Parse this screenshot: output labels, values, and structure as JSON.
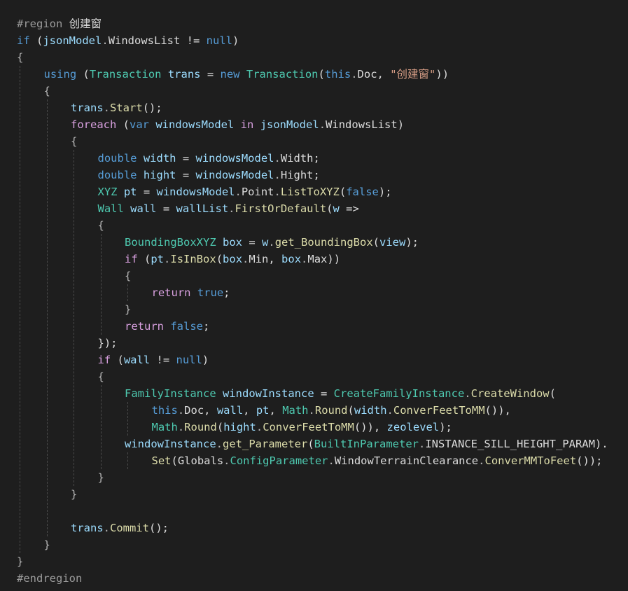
{
  "editor": {
    "language": "C#",
    "theme": "dark",
    "colors": {
      "background": "#1e1e1e",
      "keyword": "#569cd6",
      "control": "#d8a0df",
      "type": "#4ec9b0",
      "method": "#dcdcaa",
      "variable": "#9cdcfe",
      "string": "#d69d85",
      "preprocessor": "#9b9b9b"
    },
    "lines": [
      {
        "indent": 0,
        "tokens": [
          [
            "pp",
            "#region "
          ],
          [
            "plain",
            "创建窗"
          ]
        ]
      },
      {
        "indent": 0,
        "tokens": [
          [
            "kw",
            "if"
          ],
          [
            "plain",
            " ("
          ],
          [
            "var",
            "jsonModel"
          ],
          [
            "pun",
            "."
          ],
          [
            "prop",
            "WindowsList"
          ],
          [
            "plain",
            " != "
          ],
          [
            "kw",
            "null"
          ],
          [
            "plain",
            ")"
          ]
        ]
      },
      {
        "indent": 0,
        "tokens": [
          [
            "pun",
            "{"
          ]
        ]
      },
      {
        "indent": 1,
        "tokens": [
          [
            "kw",
            "using"
          ],
          [
            "plain",
            " ("
          ],
          [
            "ty",
            "Transaction"
          ],
          [
            "plain",
            " "
          ],
          [
            "var",
            "trans"
          ],
          [
            "plain",
            " = "
          ],
          [
            "kw",
            "new"
          ],
          [
            "plain",
            " "
          ],
          [
            "ty",
            "Transaction"
          ],
          [
            "plain",
            "("
          ],
          [
            "kw",
            "this"
          ],
          [
            "pun",
            "."
          ],
          [
            "prop",
            "Doc"
          ],
          [
            "plain",
            ", "
          ],
          [
            "str",
            "\"创建窗\""
          ],
          [
            "plain",
            "))"
          ]
        ]
      },
      {
        "indent": 1,
        "tokens": [
          [
            "pun",
            "{"
          ]
        ]
      },
      {
        "indent": 2,
        "tokens": [
          [
            "var",
            "trans"
          ],
          [
            "pun",
            "."
          ],
          [
            "fn",
            "Start"
          ],
          [
            "plain",
            "();"
          ]
        ]
      },
      {
        "indent": 2,
        "tokens": [
          [
            "ctl",
            "foreach"
          ],
          [
            "plain",
            " ("
          ],
          [
            "kw",
            "var"
          ],
          [
            "plain",
            " "
          ],
          [
            "var",
            "windowsModel"
          ],
          [
            "plain",
            " "
          ],
          [
            "ctl",
            "in"
          ],
          [
            "plain",
            " "
          ],
          [
            "var",
            "jsonModel"
          ],
          [
            "pun",
            "."
          ],
          [
            "prop",
            "WindowsList"
          ],
          [
            "plain",
            ")"
          ]
        ]
      },
      {
        "indent": 2,
        "tokens": [
          [
            "pun",
            "{"
          ]
        ]
      },
      {
        "indent": 3,
        "tokens": [
          [
            "kw",
            "double"
          ],
          [
            "plain",
            " "
          ],
          [
            "var",
            "width"
          ],
          [
            "plain",
            " = "
          ],
          [
            "var",
            "windowsModel"
          ],
          [
            "pun",
            "."
          ],
          [
            "prop",
            "Width"
          ],
          [
            "plain",
            ";"
          ]
        ]
      },
      {
        "indent": 3,
        "tokens": [
          [
            "kw",
            "double"
          ],
          [
            "plain",
            " "
          ],
          [
            "var",
            "hight"
          ],
          [
            "plain",
            " = "
          ],
          [
            "var",
            "windowsModel"
          ],
          [
            "pun",
            "."
          ],
          [
            "prop",
            "Hight"
          ],
          [
            "plain",
            ";"
          ]
        ]
      },
      {
        "indent": 3,
        "tokens": [
          [
            "ty",
            "XYZ"
          ],
          [
            "plain",
            " "
          ],
          [
            "var",
            "pt"
          ],
          [
            "plain",
            " = "
          ],
          [
            "var",
            "windowsModel"
          ],
          [
            "pun",
            "."
          ],
          [
            "prop",
            "Point"
          ],
          [
            "pun",
            "."
          ],
          [
            "fn",
            "ListToXYZ"
          ],
          [
            "plain",
            "("
          ],
          [
            "kw",
            "false"
          ],
          [
            "plain",
            ");"
          ]
        ]
      },
      {
        "indent": 3,
        "tokens": [
          [
            "ty",
            "Wall"
          ],
          [
            "plain",
            " "
          ],
          [
            "var",
            "wall"
          ],
          [
            "plain",
            " = "
          ],
          [
            "var",
            "wallList"
          ],
          [
            "pun",
            "."
          ],
          [
            "fn",
            "FirstOrDefault"
          ],
          [
            "plain",
            "("
          ],
          [
            "var",
            "w"
          ],
          [
            "plain",
            " =>"
          ]
        ]
      },
      {
        "indent": 3,
        "tokens": [
          [
            "pun",
            "{"
          ]
        ]
      },
      {
        "indent": 4,
        "tokens": [
          [
            "ty",
            "BoundingBoxXYZ"
          ],
          [
            "plain",
            " "
          ],
          [
            "var",
            "box"
          ],
          [
            "plain",
            " = "
          ],
          [
            "var",
            "w"
          ],
          [
            "pun",
            "."
          ],
          [
            "fn",
            "get_BoundingBox"
          ],
          [
            "plain",
            "("
          ],
          [
            "var",
            "view"
          ],
          [
            "plain",
            ");"
          ]
        ]
      },
      {
        "indent": 4,
        "tokens": [
          [
            "ctl",
            "if"
          ],
          [
            "plain",
            " ("
          ],
          [
            "var",
            "pt"
          ],
          [
            "pun",
            "."
          ],
          [
            "fn",
            "IsInBox"
          ],
          [
            "plain",
            "("
          ],
          [
            "var",
            "box"
          ],
          [
            "pun",
            "."
          ],
          [
            "prop",
            "Min"
          ],
          [
            "plain",
            ", "
          ],
          [
            "var",
            "box"
          ],
          [
            "pun",
            "."
          ],
          [
            "prop",
            "Max"
          ],
          [
            "plain",
            "))"
          ]
        ]
      },
      {
        "indent": 4,
        "tokens": [
          [
            "pun",
            "{"
          ]
        ]
      },
      {
        "indent": 5,
        "tokens": [
          [
            "ctl",
            "return"
          ],
          [
            "plain",
            " "
          ],
          [
            "kw",
            "true"
          ],
          [
            "plain",
            ";"
          ]
        ]
      },
      {
        "indent": 4,
        "tokens": [
          [
            "pun",
            "}"
          ]
        ]
      },
      {
        "indent": 4,
        "tokens": [
          [
            "ctl",
            "return"
          ],
          [
            "plain",
            " "
          ],
          [
            "kw",
            "false"
          ],
          [
            "plain",
            ";"
          ]
        ]
      },
      {
        "indent": 3,
        "tokens": [
          [
            "plain",
            "});"
          ]
        ]
      },
      {
        "indent": 3,
        "tokens": [
          [
            "ctl",
            "if"
          ],
          [
            "plain",
            " ("
          ],
          [
            "var",
            "wall"
          ],
          [
            "plain",
            " != "
          ],
          [
            "kw",
            "null"
          ],
          [
            "plain",
            ")"
          ]
        ]
      },
      {
        "indent": 3,
        "tokens": [
          [
            "pun",
            "{"
          ]
        ]
      },
      {
        "indent": 4,
        "tokens": [
          [
            "ty",
            "FamilyInstance"
          ],
          [
            "plain",
            " "
          ],
          [
            "var",
            "windowInstance"
          ],
          [
            "plain",
            " = "
          ],
          [
            "ty",
            "CreateFamilyInstance"
          ],
          [
            "pun",
            "."
          ],
          [
            "fn",
            "CreateWindow"
          ],
          [
            "plain",
            "("
          ]
        ]
      },
      {
        "indent": 5,
        "tokens": [
          [
            "kw",
            "this"
          ],
          [
            "pun",
            "."
          ],
          [
            "prop",
            "Doc"
          ],
          [
            "plain",
            ", "
          ],
          [
            "var",
            "wall"
          ],
          [
            "plain",
            ", "
          ],
          [
            "var",
            "pt"
          ],
          [
            "plain",
            ", "
          ],
          [
            "ty",
            "Math"
          ],
          [
            "pun",
            "."
          ],
          [
            "fn",
            "Round"
          ],
          [
            "plain",
            "("
          ],
          [
            "var",
            "width"
          ],
          [
            "pun",
            "."
          ],
          [
            "fn",
            "ConverFeetToMM"
          ],
          [
            "plain",
            "()),"
          ]
        ]
      },
      {
        "indent": 5,
        "tokens": [
          [
            "ty",
            "Math"
          ],
          [
            "pun",
            "."
          ],
          [
            "fn",
            "Round"
          ],
          [
            "plain",
            "("
          ],
          [
            "var",
            "hight"
          ],
          [
            "pun",
            "."
          ],
          [
            "fn",
            "ConverFeetToMM"
          ],
          [
            "plain",
            "()), "
          ],
          [
            "var",
            "zeolevel"
          ],
          [
            "plain",
            ");"
          ]
        ]
      },
      {
        "indent": 4,
        "tokens": [
          [
            "var",
            "windowInstance"
          ],
          [
            "pun",
            "."
          ],
          [
            "fn",
            "get_Parameter"
          ],
          [
            "plain",
            "("
          ],
          [
            "ty",
            "BuiltInParameter"
          ],
          [
            "pun",
            "."
          ],
          [
            "prop",
            "INSTANCE_SILL_HEIGHT_PARAM"
          ],
          [
            "plain",
            ")."
          ]
        ]
      },
      {
        "indent": 5,
        "tokens": [
          [
            "fn",
            "Set"
          ],
          [
            "plain",
            "("
          ],
          [
            "prop",
            "Globals"
          ],
          [
            "pun",
            "."
          ],
          [
            "ty",
            "ConfigParameter"
          ],
          [
            "pun",
            "."
          ],
          [
            "prop",
            "WindowTerrainClearance"
          ],
          [
            "pun",
            "."
          ],
          [
            "fn",
            "ConverMMToFeet"
          ],
          [
            "plain",
            "());"
          ]
        ]
      },
      {
        "indent": 3,
        "tokens": [
          [
            "pun",
            "}"
          ]
        ]
      },
      {
        "indent": 2,
        "tokens": [
          [
            "pun",
            "}"
          ]
        ]
      },
      {
        "indent": 2,
        "tokens": []
      },
      {
        "indent": 2,
        "tokens": [
          [
            "var",
            "trans"
          ],
          [
            "pun",
            "."
          ],
          [
            "fn",
            "Commit"
          ],
          [
            "plain",
            "();"
          ]
        ]
      },
      {
        "indent": 1,
        "tokens": [
          [
            "pun",
            "}"
          ]
        ]
      },
      {
        "indent": 0,
        "tokens": [
          [
            "pun",
            "}"
          ]
        ]
      },
      {
        "indent": 0,
        "tokens": [
          [
            "pp",
            "#endregion"
          ]
        ]
      }
    ]
  }
}
